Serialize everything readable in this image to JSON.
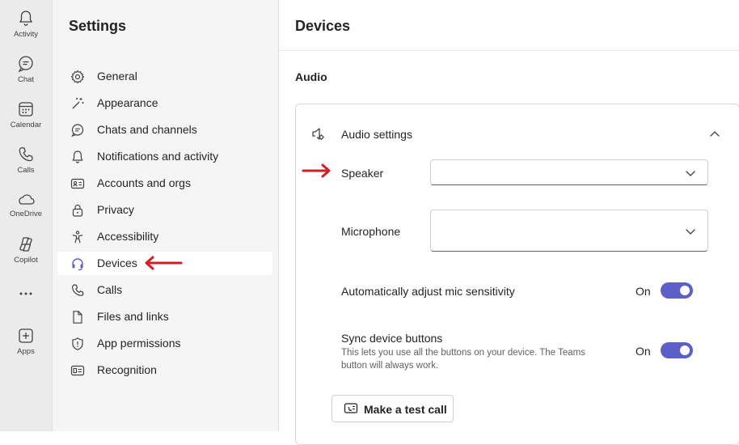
{
  "rail": {
    "items": [
      {
        "label": "Activity",
        "icon": "bell-icon"
      },
      {
        "label": "Chat",
        "icon": "chat-icon"
      },
      {
        "label": "Calendar",
        "icon": "calendar-icon"
      },
      {
        "label": "Calls",
        "icon": "phone-icon"
      },
      {
        "label": "OneDrive",
        "icon": "cloud-icon"
      },
      {
        "label": "Copilot",
        "icon": "copilot-icon"
      },
      {
        "label": "Apps",
        "icon": "add-app-icon"
      }
    ],
    "more_icon": "more-icon"
  },
  "settings": {
    "title": "Settings",
    "items": [
      {
        "label": "General",
        "icon": "gear-icon"
      },
      {
        "label": "Appearance",
        "icon": "magic-wand-icon"
      },
      {
        "label": "Chats and channels",
        "icon": "chat-bubble-icon"
      },
      {
        "label": "Notifications and activity",
        "icon": "bell-icon"
      },
      {
        "label": "Accounts and orgs",
        "icon": "contact-card-icon"
      },
      {
        "label": "Privacy",
        "icon": "lock-icon"
      },
      {
        "label": "Accessibility",
        "icon": "accessibility-icon"
      },
      {
        "label": "Devices",
        "icon": "headset-icon",
        "selected": true
      },
      {
        "label": "Calls",
        "icon": "phone-icon"
      },
      {
        "label": "Files and links",
        "icon": "document-icon"
      },
      {
        "label": "App permissions",
        "icon": "shield-icon"
      },
      {
        "label": "Recognition",
        "icon": "id-card-icon"
      }
    ]
  },
  "main": {
    "title": "Devices",
    "section": "Audio",
    "audio_settings": {
      "header": "Audio settings",
      "speaker_label": "Speaker",
      "speaker_value": "",
      "microphone_label": "Microphone",
      "microphone_value": "",
      "auto_mic_label": "Automatically adjust mic sensitivity",
      "auto_mic_state": "On",
      "sync_label": "Sync device buttons",
      "sync_desc_line1": "This lets you use all the buttons on your device. The Teams",
      "sync_desc_line2": "button will always work.",
      "sync_state": "On",
      "test_call_label": "Make a test call"
    }
  },
  "colors": {
    "accent": "#5b5fc7",
    "annotation_arrow": "#d21f27",
    "nav_bg": "#f5f5f5",
    "rail_bg": "#ebebeb"
  }
}
